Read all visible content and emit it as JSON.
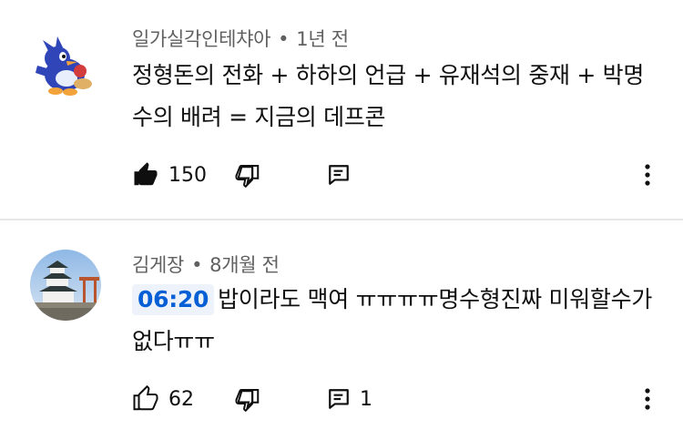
{
  "comments": [
    {
      "author": "일가실각인테챠아",
      "time": "1년 전",
      "timestamp": "",
      "text": "정형돈의 전화 + 하하의 언급 + 유재석의 중재 + 박명수의 배려 = 지금의 데프콘",
      "likes": "150",
      "replies": "",
      "liked": true
    },
    {
      "author": "김게장",
      "time": "8개월 전",
      "timestamp": "06:20",
      "text": "밥이라도 맥여 ㅠㅠㅠㅠ명수형진짜 미워할수가없다ㅠㅠ",
      "likes": "62",
      "replies": "1",
      "liked": false
    }
  ],
  "separator": "•",
  "colors": {
    "link": "#065fd4",
    "meta": "#606060",
    "text": "#0f0f0f"
  },
  "icons": [
    "avatar-penguin",
    "avatar-castle",
    "thumbs-up-icon",
    "thumbs-down-icon",
    "reply-icon",
    "more-vert-icon"
  ]
}
